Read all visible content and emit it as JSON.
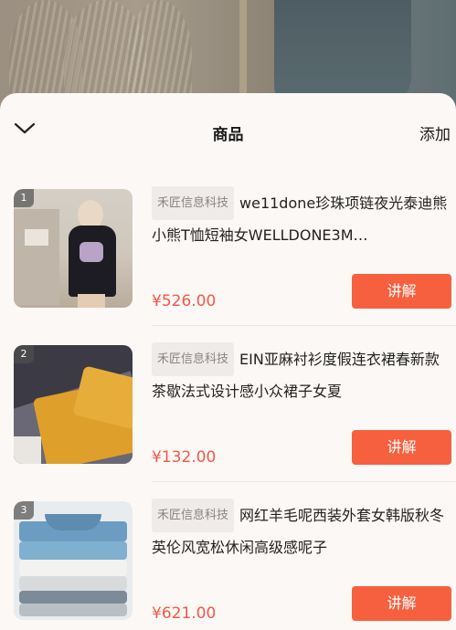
{
  "header": {
    "title": "商品",
    "add_label": "添加"
  },
  "products": [
    {
      "rank": "1",
      "shop": "禾匠信息科技",
      "name": "we11done珍珠项链夜光泰迪熊小熊T恤短袖女WELLDONE3M…",
      "price": "¥526.00",
      "button": "讲解"
    },
    {
      "rank": "2",
      "shop": "禾匠信息科技",
      "name": "EIN亚麻衬衫度假连衣裙春新款茶歇法式设计感小众裙子女夏",
      "price": "¥132.00",
      "button": "讲解"
    },
    {
      "rank": "3",
      "shop": "禾匠信息科技",
      "name": "网红羊毛呢西装外套女韩版秋冬英伦风宽松休闲高级感呢子",
      "price": "¥621.00",
      "button": "讲解"
    }
  ],
  "colors": {
    "accent": "#f6603f",
    "price": "#f2584a",
    "sheet_bg": "#fcf8f5"
  },
  "icons": {
    "collapse": "chevron-down-icon"
  }
}
